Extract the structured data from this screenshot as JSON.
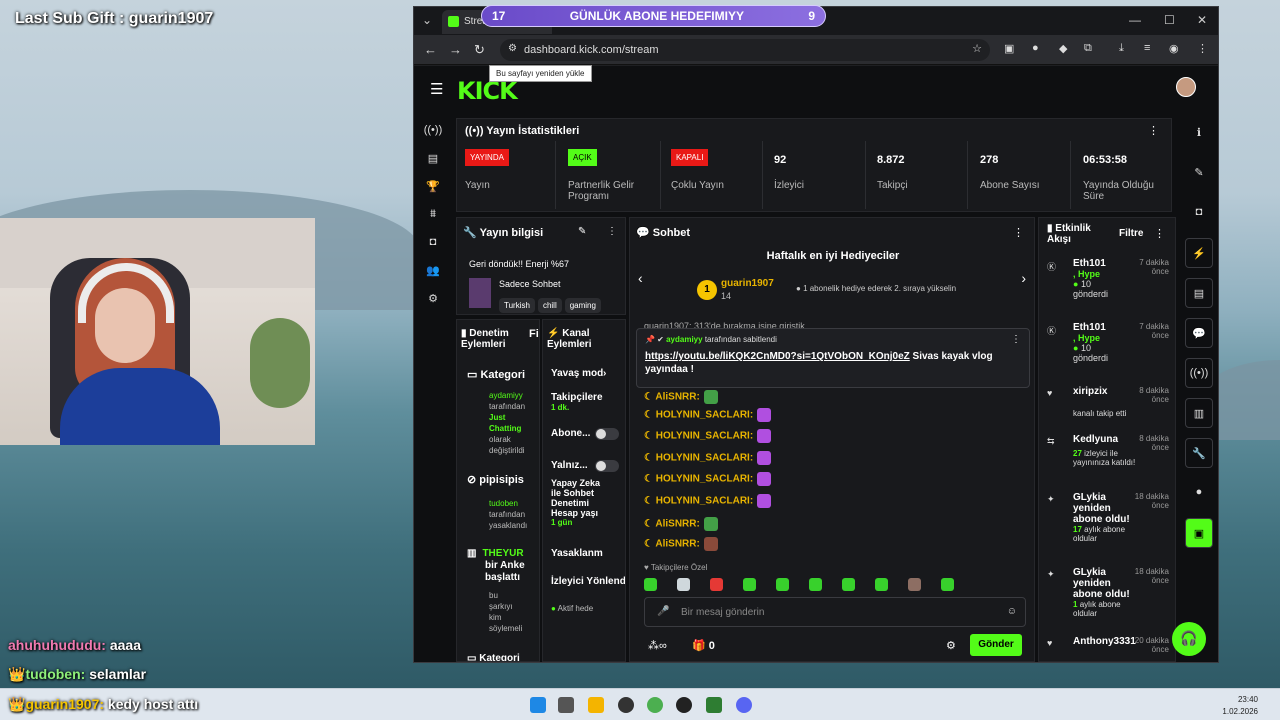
{
  "overlay": {
    "last_sub": "Last Sub Gift : guarin1907",
    "chat": [
      {
        "user": "ahuhuhududu:",
        "msg": "aaaa"
      },
      {
        "user": "tudoben:",
        "msg": "selamlar"
      },
      {
        "user": "guarin1907:",
        "msg": "kedy host attı"
      }
    ]
  },
  "goal": {
    "left": "17",
    "title": "GÜNLÜK ABONE HEDEFIMIYY",
    "right": "9"
  },
  "browser": {
    "tab": "Stream",
    "url": "dashboard.kick.com/stream",
    "tooltip": "Bu sayfayı yeniden yükle"
  },
  "kick": {
    "logo": "KICK"
  },
  "stats": {
    "title": "Yayın İstatistikleri",
    "items": [
      {
        "badge": "YAYINDA",
        "label": "Yayın",
        "color": "#e91916"
      },
      {
        "badge": "AÇIK",
        "label": "Partnerlik Gelir Programı",
        "color": "#53fc18"
      },
      {
        "badge": "KAPALI",
        "label": "Çoklu Yayın",
        "color": "#e91916"
      },
      {
        "value": "92",
        "label": "İzleyici"
      },
      {
        "value": "8.872",
        "label": "Takipçi"
      },
      {
        "value": "278",
        "label": "Abone Sayısı"
      },
      {
        "value": "06:53:58",
        "label": "Yayında Olduğu Süre"
      }
    ]
  },
  "info": {
    "title": "Yayın bilgisi",
    "stream_title": "Geri döndük!! Enerji %67",
    "category": "Sadece Sohbet",
    "tags": [
      "Turkish",
      "chill",
      "gaming"
    ]
  },
  "mod": {
    "title": "Denetim Eylemleri",
    "fi": "Fi",
    "items": [
      {
        "title": "Kategori",
        "sub1": "aydamiyy",
        "sub2": "tarafından",
        "sub3": "Just Chatting",
        "sub4": "olarak değiştirildi"
      },
      {
        "title": "pipisipis",
        "sub1": "tudoben",
        "sub2": "tarafından",
        "sub3": "yasaklandı"
      },
      {
        "title": "THEYUR",
        "title2": "bir Anke",
        "title3": "başlattı",
        "sub1": "bu",
        "sub2": "şarkıyı",
        "sub3": "kim",
        "sub4": "söylemeli"
      },
      {
        "title": "Kategori"
      }
    ]
  },
  "channel": {
    "title": "Kanal Eylemleri",
    "slow": "Yavaş mod",
    "followers": "Takipçilere",
    "followers_val": "1 dk.",
    "subs": "Abone...",
    "only": "Yalnız...",
    "ai": "Yapay Zeka ile Sohbet Denetimi Hesap yaşı",
    "ai_val": "1 gün",
    "banned": "Yasaklanm",
    "viewer": "İzleyici Yönlend",
    "active": "Aktif hede"
  },
  "chat": {
    "title": "Sohbet",
    "gifters_title": "Haftalık en iyi Hediyeciler",
    "gifter": "guarin1907",
    "gifter_count": "14",
    "gifter_rank": "1",
    "gift_tip": "1 abonelik hediye ederek 2. sıraya yükselin",
    "pinned_by": "aydamiyy",
    "pinned_suffix": "tarafından sabitlendi",
    "pinned_link": "https://youtu.be/liKQK2CnMD0?si=1QtVObON_KOnj0eZ",
    "pinned_text": "Sivas kayak vlog yayındaa !",
    "top_cut": "guarin1907: 313'de bırakma işine giriştik",
    "messages": [
      "AliSNRR:",
      "HOLYNIN_SACLARI:",
      "HOLYNIN_SACLARI:",
      "HOLYNIN_SACLARI:",
      "HOLYNIN_SACLARI:",
      "HOLYNIN_SACLARI:",
      "AliSNRR:",
      "AliSNRR:"
    ],
    "followers_only": "Takipçilere Özel",
    "placeholder": "Bir mesaj gönderin",
    "count": "0",
    "send": "Gönder"
  },
  "events": {
    "title": "Etkinlik Akışı",
    "filter": "Filtre",
    "items": [
      {
        "user": "Eth101",
        "time": "7 dakika önce",
        "l1": ", Hype",
        "l2": "10",
        "l3": "gönderdi"
      },
      {
        "user": "Eth101",
        "time": "7 dakika önce",
        "l1": ", Hype",
        "l2": "10",
        "l3": "gönderdi"
      },
      {
        "user": "xiripzix",
        "time": "8 dakika önce",
        "l1": "kanalı takip etti"
      },
      {
        "user": "Kedlyuna",
        "time": "8 dakika önce",
        "l1": "27",
        "l2": "izleyici ile yayınınıza katıldı!"
      },
      {
        "user": "GLykia yeniden abone oldu!",
        "time": "18 dakika önce",
        "l1": "17",
        "l2": "aylık abone oldular"
      },
      {
        "user": "GLykia yeniden abone oldu!",
        "time": "18 dakika önce",
        "l1": "1",
        "l2": "aylık abone oldular"
      },
      {
        "user": "Anthony3331",
        "time": "20 dakika önce"
      }
    ]
  },
  "clock": {
    "time": "23:40",
    "date": "1.02.2026"
  },
  "colors": {
    "kick_green": "#53fc18",
    "live_red": "#e91916"
  }
}
